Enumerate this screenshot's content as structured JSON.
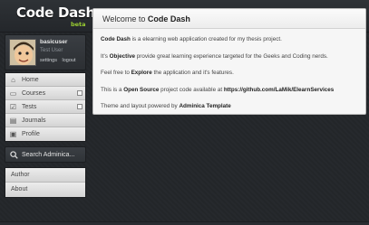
{
  "app": {
    "logo_text": "Code Dash",
    "logo_badge": "beta"
  },
  "user": {
    "name": "basicuser",
    "role": "Test User",
    "settings_link": "settings",
    "logout_link": "logout",
    "avatar_icon": "cartoon-face-avatar"
  },
  "nav": {
    "items": [
      {
        "label": "Home",
        "icon": "home-icon"
      },
      {
        "label": "Courses",
        "icon": "folder-icon"
      },
      {
        "label": "Tests",
        "icon": "checkbox-icon"
      },
      {
        "label": "Journals",
        "icon": "journal-icon"
      },
      {
        "label": "Profile",
        "icon": "profile-icon"
      }
    ]
  },
  "search": {
    "label": "Search Adminica..."
  },
  "extra_nav": {
    "items": [
      {
        "label": "Author"
      },
      {
        "label": "About"
      }
    ]
  },
  "main": {
    "title_prefix": "Welcome to",
    "title_name": "Code Dash",
    "p1_strong": "Code Dash",
    "p1_text": " is a elearning web application created for my thesis project.",
    "p2_prefix": "It's ",
    "p2_strong": "Objective",
    "p2_text": " provide great learning experience targeted for the Geeks and Coding nerds.",
    "p3_prefix": "Feel free to ",
    "p3_strong": "Explore",
    "p3_text": " the application and it's features.",
    "p4_prefix": "This is a ",
    "p4_strong": "Open Source",
    "p4_mid": " project code available at ",
    "p4_url": "https://github.com/LaMik/ElearnServices",
    "p5_prefix": "Theme and layout powered by ",
    "p5_strong": "Adminica Template"
  }
}
